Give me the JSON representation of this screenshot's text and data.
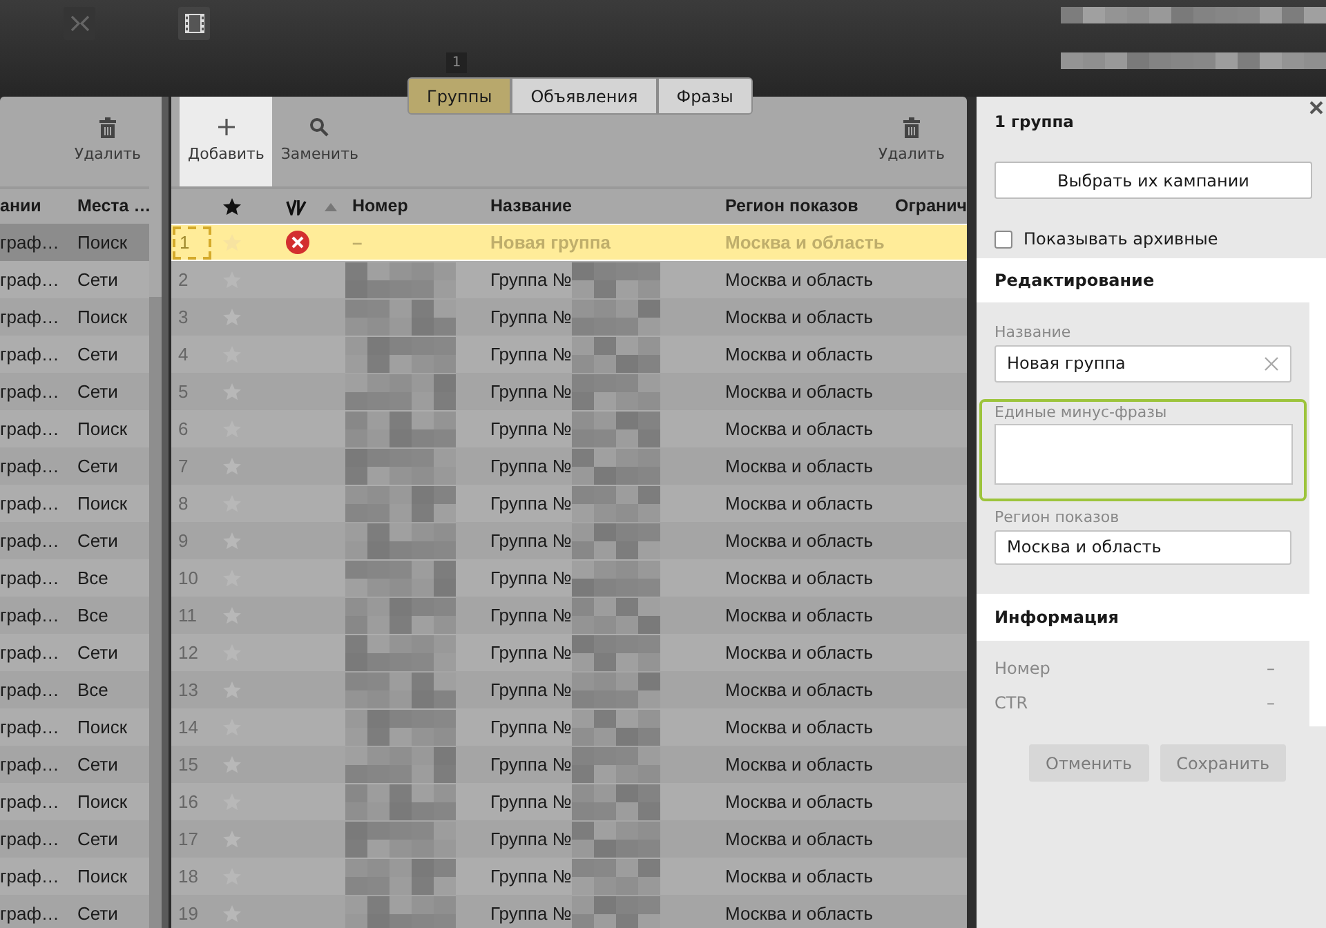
{
  "tabs": {
    "badge": "1",
    "items": [
      {
        "label": "Группы",
        "selected": true
      },
      {
        "label": "Объявления",
        "selected": false
      },
      {
        "label": "Фразы",
        "selected": false
      }
    ]
  },
  "campaigns_panel": {
    "delete_label": "Удалить",
    "columns": [
      "ании",
      "Места …"
    ],
    "rows": [
      {
        "cells": [
          "граф…",
          "Поиск"
        ],
        "selected": true
      },
      {
        "cells": [
          "граф…",
          "Сети"
        ],
        "selected": false
      },
      {
        "cells": [
          "граф…",
          "Поиск"
        ],
        "selected": false
      },
      {
        "cells": [
          "граф…",
          "Сети"
        ],
        "selected": false
      },
      {
        "cells": [
          "граф…",
          "Сети"
        ],
        "selected": false
      },
      {
        "cells": [
          "граф…",
          "Поиск"
        ],
        "selected": false
      },
      {
        "cells": [
          "граф…",
          "Сети"
        ],
        "selected": false
      },
      {
        "cells": [
          "граф…",
          "Поиск"
        ],
        "selected": false
      },
      {
        "cells": [
          "граф…",
          "Сети"
        ],
        "selected": false
      },
      {
        "cells": [
          "граф…",
          "Все"
        ],
        "selected": false
      },
      {
        "cells": [
          "граф…",
          "Все"
        ],
        "selected": false
      },
      {
        "cells": [
          "граф…",
          "Сети"
        ],
        "selected": false
      },
      {
        "cells": [
          "граф…",
          "Все"
        ],
        "selected": false
      },
      {
        "cells": [
          "граф…",
          "Поиск"
        ],
        "selected": false
      },
      {
        "cells": [
          "граф…",
          "Сети"
        ],
        "selected": false
      },
      {
        "cells": [
          "граф…",
          "Поиск"
        ],
        "selected": false
      },
      {
        "cells": [
          "граф…",
          "Сети"
        ],
        "selected": false
      },
      {
        "cells": [
          "граф…",
          "Поиск"
        ],
        "selected": false
      },
      {
        "cells": [
          "граф…",
          "Сети"
        ],
        "selected": false
      }
    ]
  },
  "groups_panel": {
    "toolbar": [
      {
        "kind": "add",
        "label": "Добавить",
        "active": true
      },
      {
        "kind": "replace",
        "label": "Заменить",
        "active": false
      },
      {
        "kind": "delete",
        "label": "Удалить",
        "active": false
      }
    ],
    "columns": [
      "Номер",
      "Название",
      "Регион показов",
      "Огранич"
    ],
    "rows": [
      {
        "index": "1",
        "number": "–",
        "name": "Новая группа",
        "region": "Москва и область",
        "selected": true,
        "error": true,
        "redacted": false
      },
      {
        "index": "2",
        "name": "Группа №",
        "region": "Москва и область",
        "selected": false,
        "error": false,
        "redacted": true
      },
      {
        "index": "3",
        "name": "Группа №",
        "region": "Москва и область",
        "selected": false,
        "error": false,
        "redacted": true
      },
      {
        "index": "4",
        "name": "Группа №",
        "region": "Москва и область",
        "selected": false,
        "error": false,
        "redacted": true
      },
      {
        "index": "5",
        "name": "Группа №",
        "region": "Москва и область",
        "selected": false,
        "error": false,
        "redacted": true
      },
      {
        "index": "6",
        "name": "Группа №",
        "region": "Москва и область",
        "selected": false,
        "error": false,
        "redacted": true
      },
      {
        "index": "7",
        "name": "Группа №",
        "region": "Москва и область",
        "selected": false,
        "error": false,
        "redacted": true
      },
      {
        "index": "8",
        "name": "Группа №",
        "region": "Москва и область",
        "selected": false,
        "error": false,
        "redacted": true
      },
      {
        "index": "9",
        "name": "Группа №",
        "region": "Москва и область",
        "selected": false,
        "error": false,
        "redacted": true
      },
      {
        "index": "10",
        "name": "Группа №",
        "region": "Москва и область",
        "selected": false,
        "error": false,
        "redacted": true
      },
      {
        "index": "11",
        "name": "Группа №",
        "region": "Москва и область",
        "selected": false,
        "error": false,
        "redacted": true
      },
      {
        "index": "12",
        "name": "Группа №",
        "region": "Москва и область",
        "selected": false,
        "error": false,
        "redacted": true
      },
      {
        "index": "13",
        "name": "Группа №",
        "region": "Москва и область",
        "selected": false,
        "error": false,
        "redacted": true
      },
      {
        "index": "14",
        "name": "Группа №",
        "region": "Москва и область",
        "selected": false,
        "error": false,
        "redacted": true
      },
      {
        "index": "15",
        "name": "Группа №",
        "region": "Москва и область",
        "selected": false,
        "error": false,
        "redacted": true
      },
      {
        "index": "16",
        "name": "Группа №",
        "region": "Москва и область",
        "selected": false,
        "error": false,
        "redacted": true
      },
      {
        "index": "17",
        "name": "Группа №",
        "region": "Москва и область",
        "selected": false,
        "error": false,
        "redacted": true
      },
      {
        "index": "18",
        "name": "Группа №",
        "region": "Москва и область",
        "selected": false,
        "error": false,
        "redacted": true
      },
      {
        "index": "19",
        "name": "Группа №",
        "region": "Москва и область",
        "selected": false,
        "error": false,
        "redacted": true
      }
    ]
  },
  "editor": {
    "title": "1 группа",
    "choose_button": "Выбрать их кампании",
    "show_archived": {
      "label": "Показывать архивные",
      "checked": false
    },
    "editing": {
      "title": "Редактирование",
      "fields": [
        {
          "kind": "input",
          "label": "Название",
          "value": "Новая группа",
          "clearable": true
        },
        {
          "kind": "textarea",
          "label": "Единые минус-фразы",
          "highlighted": true
        },
        {
          "kind": "input",
          "label": "Регион показов",
          "value": "Москва и область"
        }
      ]
    },
    "info": {
      "title": "Информация",
      "rows": [
        {
          "label": "Номер",
          "value": "–"
        },
        {
          "label": "CTR",
          "value": "–"
        }
      ]
    },
    "buttons": [
      {
        "label": "Отменить",
        "disabled": true
      },
      {
        "label": "Сохранить",
        "disabled": true
      }
    ]
  }
}
